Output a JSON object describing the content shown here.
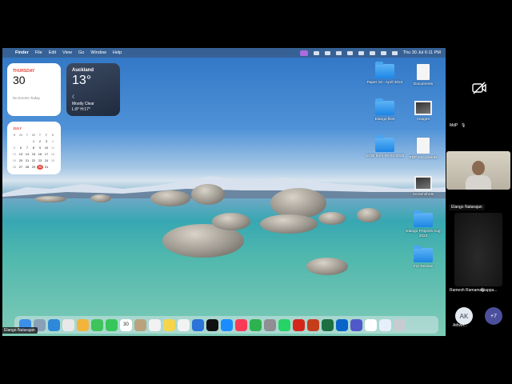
{
  "menubar": {
    "apple": "",
    "items": [
      "Finder",
      "File",
      "Edit",
      "View",
      "Go",
      "Window",
      "Help"
    ],
    "clock": "Thu 30 Jul  6:11 PM"
  },
  "widgets": {
    "calendar_day": {
      "weekday": "THURSDAY",
      "date": "30",
      "events": "No Events Today"
    },
    "weather": {
      "city": "Auckland",
      "temp": "13°",
      "icon": "moon-icon",
      "condition": "Mostly Clear",
      "hilo": "L:8° H:17°"
    },
    "month": {
      "name": "JULY",
      "headers": [
        "S",
        "M",
        "T",
        "W",
        "T",
        "F",
        "S"
      ],
      "days": [
        "",
        "",
        "",
        "1",
        "2",
        "3",
        "4",
        "5",
        "6",
        "7",
        "8",
        "9",
        "10",
        "11",
        "12",
        "13",
        "14",
        "15",
        "16",
        "17",
        "18",
        "19",
        "20",
        "21",
        "22",
        "23",
        "24",
        "25",
        "26",
        "27",
        "28",
        "29",
        "30",
        "31",
        ""
      ],
      "today": "30"
    }
  },
  "desktop": {
    "icons": [
      {
        "label": "Paper 16 - April 2024",
        "kind": "folder"
      },
      {
        "label": "Documents",
        "kind": "doc"
      },
      {
        "label": "Elango files",
        "kind": "folder"
      },
      {
        "label": "Images",
        "kind": "img"
      },
      {
        "label": "UCSI from 05-03-2015",
        "kind": "folder"
      },
      {
        "label": "PDF Documents",
        "kind": "doc"
      },
      {
        "label": "Screenshots",
        "kind": "img"
      },
      {
        "label": "Elango Projects Aug 2023",
        "kind": "folder"
      },
      {
        "label": "For Review",
        "kind": "folder"
      }
    ]
  },
  "dock": {
    "calendar_date": "30",
    "apps": [
      "finder-icon",
      "launchpad-icon",
      "safari-icon",
      "chrome-icon",
      "photos-icon",
      "facetime-icon",
      "messages-icon",
      "calendar-icon",
      "contacts-icon",
      "reminders-icon",
      "notes-icon",
      "freeform-icon",
      "keynote-icon",
      "appletv-icon",
      "appstore-icon",
      "music-icon",
      "numbers-icon",
      "settings-icon",
      "whatsapp-icon",
      "acrobat-icon",
      "powerpoint-icon",
      "excel-icon",
      "outlook-icon",
      "teams-icon",
      "help-icon",
      "preview-icon",
      "trash-icon"
    ]
  },
  "screen_share": {
    "presenter_tag": "Elango Natarajan"
  },
  "participants": {
    "muted_label": "MdP",
    "tile1_name": "Elango Natarajan",
    "tile2_name": "Ramesh Ramamaniappa...",
    "avatar_initials": "AK",
    "avatar_name": "Athvel...",
    "more_count": "+7"
  },
  "colors": {
    "accent": "#6f5ad6",
    "folder": "#2b8de8",
    "calendar_red": "#e4463c"
  }
}
